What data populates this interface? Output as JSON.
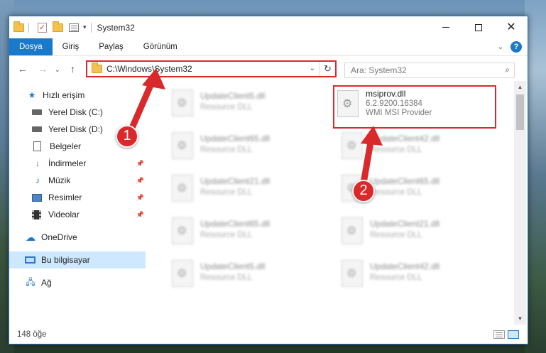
{
  "window": {
    "title": "System32"
  },
  "ribbon": {
    "tabs": [
      "Dosya",
      "Giriş",
      "Paylaş",
      "Görünüm"
    ]
  },
  "address": {
    "path": "C:\\Windows\\System32"
  },
  "search": {
    "placeholder": "Ara: System32"
  },
  "sidebar": {
    "items": [
      {
        "label": "Hızlı erişim",
        "icon": "star-icon"
      },
      {
        "label": "Yerel Disk (C:)",
        "icon": "drive-icon"
      },
      {
        "label": "Yerel Disk (D:)",
        "icon": "drive-icon"
      },
      {
        "label": "Belgeler",
        "icon": "document-icon"
      },
      {
        "label": "İndirmeler",
        "icon": "download-icon"
      },
      {
        "label": "Müzik",
        "icon": "music-icon"
      },
      {
        "label": "Resimler",
        "icon": "pictures-icon"
      },
      {
        "label": "Videolar",
        "icon": "video-icon"
      },
      {
        "label": "OneDrive",
        "icon": "cloud-icon"
      },
      {
        "label": "Bu bilgisayar",
        "icon": "computer-icon"
      },
      {
        "label": "Ağ",
        "icon": "network-icon"
      }
    ]
  },
  "files": {
    "highlighted": {
      "name": "msiprov.dll",
      "version": "6.2.9200.16384",
      "description": "WMI MSI Provider"
    },
    "left_column": [
      {
        "name": "UpdateClient5.dll",
        "type": "Resource DLL"
      },
      {
        "name": "UpdateClient65.dll",
        "type": "Resource DLL"
      },
      {
        "name": "UpdateClient21.dll",
        "type": "Resource DLL"
      },
      {
        "name": "UpdateClient65.dll",
        "type": "Resource DLL"
      },
      {
        "name": "UpdateClient5.dll",
        "type": "Resource DLL"
      }
    ],
    "right_column": [
      {
        "name": "UpdateClient42.dll",
        "type": "Resource DLL"
      },
      {
        "name": "UpdateClient65.dll",
        "type": "Resource DLL"
      },
      {
        "name": "UpdateClient21.dll",
        "type": "Resource DLL"
      },
      {
        "name": "UpdateClient42.dll",
        "type": "Resource DLL"
      }
    ]
  },
  "status": {
    "item_count": "148 öğe"
  },
  "annotations": {
    "step1": "1",
    "step2": "2",
    "color": "#d9292b"
  }
}
